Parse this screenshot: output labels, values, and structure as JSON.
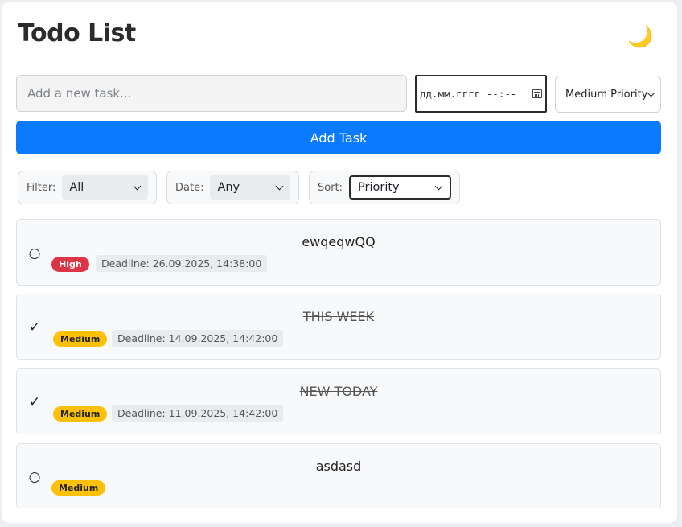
{
  "app": {
    "title": "Todo List",
    "theme_icon": "moon-icon",
    "theme_glyph": "🌙"
  },
  "new_task": {
    "placeholder": "Add a new task...",
    "deadline_value": "дд.мм.гггг --:--",
    "priority_selected": "Medium Priority",
    "add_label": "Add Task"
  },
  "filters": {
    "filter_label": "Filter:",
    "filter_value": "All",
    "date_label": "Date:",
    "date_value": "Any",
    "sort_label": "Sort:",
    "sort_value": "Priority"
  },
  "tasks": [
    {
      "name": "ewqeqwQQ",
      "completed": false,
      "check": "○",
      "priority": "High",
      "deadline": "Deadline: 26.09.2025, 14:38:00"
    },
    {
      "name": "THIS WEEK",
      "completed": true,
      "check": "✓",
      "priority": "Medium",
      "deadline": "Deadline: 14.09.2025, 14:42:00"
    },
    {
      "name": "NEW TODAY",
      "completed": true,
      "check": "✓",
      "priority": "Medium",
      "deadline": "Deadline: 11.09.2025, 14:42:00"
    },
    {
      "name": "asdasd",
      "completed": false,
      "check": "○",
      "priority": "Medium",
      "deadline": ""
    }
  ],
  "colors": {
    "primary": "#0a7bff",
    "high": "#dc3545",
    "medium": "#ffc107"
  }
}
